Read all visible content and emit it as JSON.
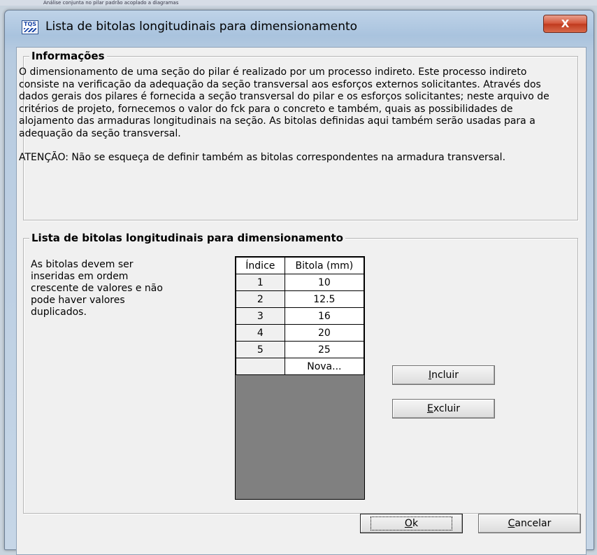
{
  "background": {
    "window_title": "Análise conjunta no pilar padrão acoplado a diagramas"
  },
  "dialog": {
    "icon": "tqs-logo-icon",
    "icon_text": "TQS",
    "title": "Lista de bitolas longitudinais para dimensionamento",
    "close_label": "X"
  },
  "info": {
    "legend": "Informações",
    "paragraph1": "O dimensionamento de uma seção do pilar é realizado por um processo indireto. Este processo indireto consiste na verificação da adequação da seção transversal aos esforços externos solicitantes. Através dos dados gerais dos pilares é fornecida a seção transversal do pilar e os esforços solicitantes; neste arquivo de critérios de projeto, fornecemos o valor do fck para o concreto e também, quais as possibilidades de alojamento das armaduras longitudinais na seção. As bitolas definidas aqui também serão usadas para a adequação da seção transversal.",
    "paragraph2": "ATENÇÃO:  Não se esqueça de definir também as bitolas correspondentes na armadura transversal."
  },
  "list": {
    "legend": "Lista de bitolas longitudinais para dimensionamento",
    "hint": "As bitolas devem ser inseridas em ordem crescente de valores e não pode haver valores duplicados.",
    "columns": [
      "Índice",
      "Bitola (mm)"
    ],
    "rows": [
      {
        "index": "1",
        "bitola": "10"
      },
      {
        "index": "2",
        "bitola": "12.5"
      },
      {
        "index": "3",
        "bitola": "16"
      },
      {
        "index": "4",
        "bitola": "20"
      },
      {
        "index": "5",
        "bitola": "25"
      },
      {
        "index": "",
        "bitola": "Nova..."
      }
    ]
  },
  "buttons": {
    "incluir_mnemonic": "I",
    "incluir_rest": "ncluir",
    "excluir_mnemonic": "E",
    "excluir_rest": "xcluir",
    "ok_mnemonic": "O",
    "ok_rest": "k",
    "cancelar_mnemonic": "C",
    "cancelar_rest": "ancelar"
  },
  "colors": {
    "close_button": "#c8452a",
    "grid_empty": "#808080",
    "dialog_face": "#f0f0f0"
  }
}
